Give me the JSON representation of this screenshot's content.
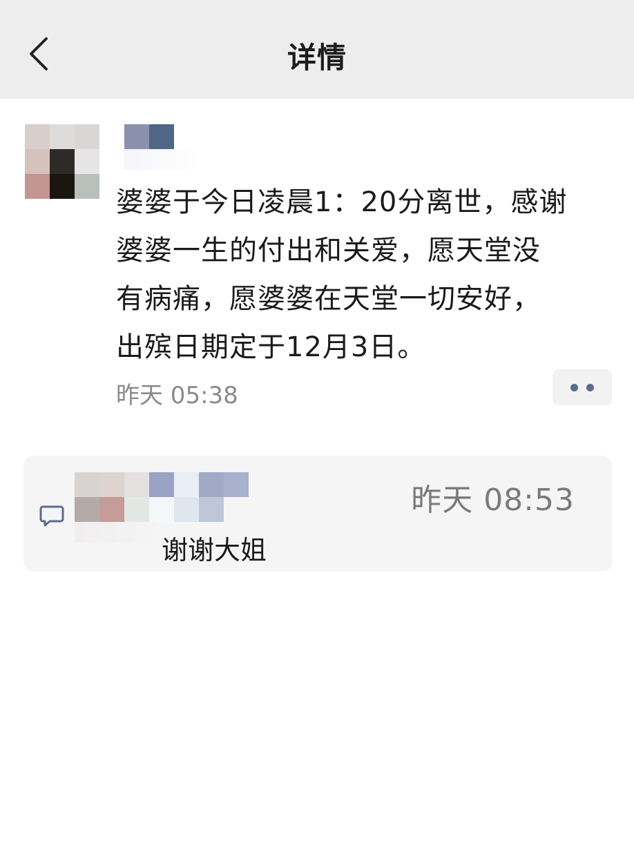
{
  "header": {
    "title": "详情",
    "back_icon": "chevron-left-icon"
  },
  "post": {
    "text": "婆婆于今日凌晨1：20分离世，感谢\n婆婆一生的付出和关爱，愿天堂没\n有病痛，愿婆婆在天堂一切安好，\n出殡日期定于12月3日。",
    "time": "昨天 05:38",
    "more_icon": "more-dots-icon"
  },
  "comment": {
    "icon": "comment-icon",
    "time": "昨天 08:53",
    "text": "谢谢大姐"
  },
  "colors": {
    "header_bg": "#ededed",
    "accent": "#5b6b8c",
    "muted_text": "#8a8a8a"
  }
}
